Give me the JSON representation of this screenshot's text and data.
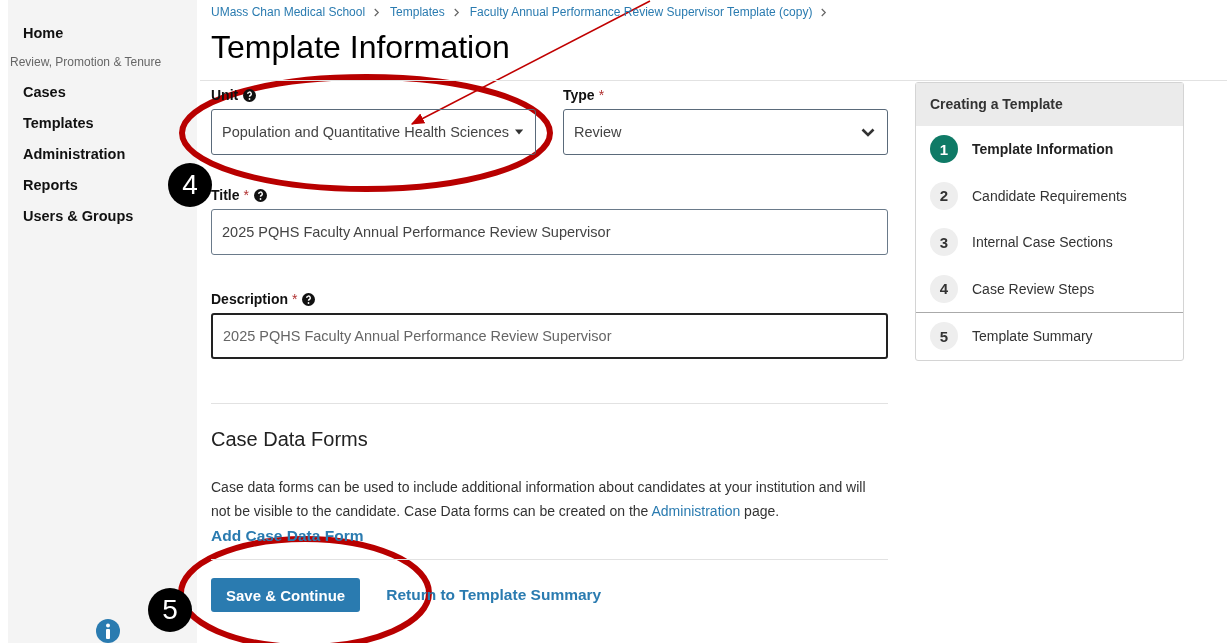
{
  "sidebar": {
    "items": [
      {
        "kind": "link",
        "label": "Home"
      },
      {
        "kind": "heading",
        "label": "Review, Promotion & Tenure"
      },
      {
        "kind": "link",
        "label": "Cases"
      },
      {
        "kind": "link",
        "label": "Templates"
      },
      {
        "kind": "link",
        "label": "Administration"
      },
      {
        "kind": "link",
        "label": "Reports"
      },
      {
        "kind": "link",
        "label": "Users & Groups"
      }
    ]
  },
  "breadcrumb": [
    "UMass Chan Medical School",
    "Templates",
    "Faculty Annual Performance Review Supervisor Template (copy)"
  ],
  "page_title": "Template Information",
  "form": {
    "row": [
      {
        "kind": "dropdown",
        "label": "Unit",
        "help": true,
        "value": "Population and Quantitative Health Sciences"
      },
      {
        "kind": "select",
        "label": "Type",
        "required_mark": "*",
        "help": false,
        "value": "Review"
      }
    ],
    "fields": [
      {
        "label": "Title",
        "required_mark": "*",
        "help": true,
        "value": "2025 PQHS Faculty Annual Performance Review Supervisor",
        "focused": false
      },
      {
        "label": "Description",
        "required_mark": "*",
        "help": true,
        "placeholder": "2025 PQHS Faculty Annual Performance Review Supervisor",
        "focused": true
      }
    ]
  },
  "case_data_forms": {
    "heading": "Case Data Forms",
    "text_before": "Case data forms can be used to include additional information about candidates at your institution and will not be visible to the candidate. Case Data forms can be created on the",
    "link": "Administration",
    "text_after": "page.",
    "add_link": "Add Case Data Form"
  },
  "actions": {
    "primary": "Save & Continue",
    "secondary": "Return to Template Summary"
  },
  "steps_panel": {
    "title": "Creating a Template",
    "steps": [
      {
        "number": "1",
        "label": "Template Information",
        "selected": true
      },
      {
        "number": "2",
        "label": "Candidate Requirements",
        "selected": false
      },
      {
        "number": "3",
        "label": "Internal Case Sections",
        "selected": false
      },
      {
        "number": "4",
        "label": "Case Review Steps",
        "selected": false
      }
    ],
    "summary_step": {
      "number": "5",
      "label": "Template Summary",
      "selected": false
    }
  },
  "annotations": {
    "callouts": [
      "4",
      "5"
    ]
  }
}
